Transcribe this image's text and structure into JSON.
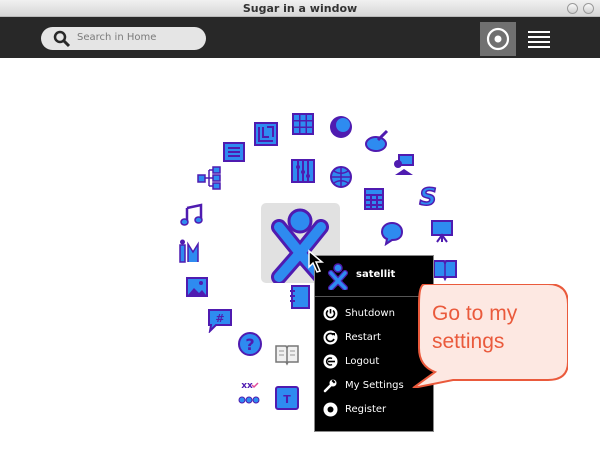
{
  "window": {
    "title": "Sugar in a window"
  },
  "toolbar": {
    "search_placeholder": "Search in Home",
    "search_icon": "search-icon",
    "favorites_view_icon": "ring-view-icon",
    "list_view_icon": "list-view-icon"
  },
  "colors": {
    "stroke": "#4f1bb0",
    "fill": "#2e8bf0",
    "accent": "#ea5a3c"
  },
  "activities": [
    "calculator",
    "chat",
    "paint",
    "turtle-art",
    "browse",
    "memorize",
    "speak",
    "maze",
    "physics",
    "music",
    "write",
    "finance",
    "labyrinth",
    "jukebox",
    "abacus",
    "pippy",
    "scratch",
    "read",
    "fototoon",
    "record",
    "measure",
    "help",
    "implode",
    "typing-turtle"
  ],
  "palette": {
    "user_name": "satellit",
    "items": [
      {
        "label": "Shutdown",
        "icon": "shutdown-icon"
      },
      {
        "label": "Restart",
        "icon": "restart-icon"
      },
      {
        "label": "Logout",
        "icon": "logout-icon"
      },
      {
        "label": "My Settings",
        "icon": "wrench-icon"
      },
      {
        "label": "Register",
        "icon": "register-icon"
      }
    ]
  },
  "annotation": {
    "line1": "Go to my",
    "line2": "settings"
  }
}
